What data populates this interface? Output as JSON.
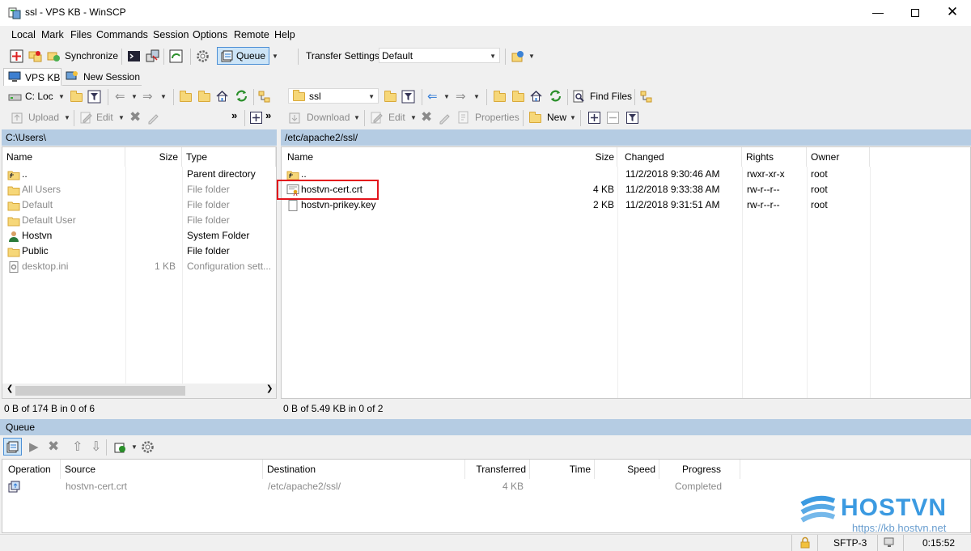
{
  "window": {
    "title": "ssl - VPS KB - WinSCP"
  },
  "menu": [
    "Local",
    "Mark",
    "Files",
    "Commands",
    "Session",
    "Options",
    "Remote",
    "Help"
  ],
  "toolbar": {
    "synchronize": "Synchronize",
    "queue": "Queue",
    "transfer_settings_label": "Transfer Settings",
    "transfer_settings_value": "Default"
  },
  "tabs": [
    {
      "label": "VPS KB"
    },
    {
      "label": "New Session"
    }
  ],
  "local": {
    "drive": "C: Loc",
    "upload": "Upload",
    "edit": "Edit",
    "path": "C:\\Users\\",
    "columns": [
      "Name",
      "Size",
      "Type"
    ],
    "rows": [
      {
        "name": "..",
        "size": "",
        "type": "Parent directory",
        "icon": "parent-folder-icon",
        "dim": false
      },
      {
        "name": "All Users",
        "size": "",
        "type": "File folder",
        "icon": "folder-icon",
        "dim": true
      },
      {
        "name": "Default",
        "size": "",
        "type": "File folder",
        "icon": "folder-icon",
        "dim": true
      },
      {
        "name": "Default User",
        "size": "",
        "type": "File folder",
        "icon": "folder-icon",
        "dim": true
      },
      {
        "name": "Hostvn",
        "size": "",
        "type": "System Folder",
        "icon": "user-icon",
        "dim": false
      },
      {
        "name": "Public",
        "size": "",
        "type": "File folder",
        "icon": "folder-icon",
        "dim": false
      },
      {
        "name": "desktop.ini",
        "size": "1 KB",
        "type": "Configuration sett...",
        "icon": "settings-file-icon",
        "dim": true
      }
    ],
    "status": "0 B of 174 B in 0 of 6"
  },
  "remote": {
    "dir": "ssl",
    "find_files": "Find Files",
    "download": "Download",
    "edit": "Edit",
    "properties": "Properties",
    "new": "New",
    "path": "/etc/apache2/ssl/",
    "columns": [
      "Name",
      "Size",
      "Changed",
      "Rights",
      "Owner"
    ],
    "rows": [
      {
        "name": "..",
        "size": "",
        "changed": "11/2/2018 9:30:46 AM",
        "rights": "rwxr-xr-x",
        "owner": "root",
        "icon": "parent-folder-icon"
      },
      {
        "name": "hostvn-cert.crt",
        "size": "4 KB",
        "changed": "11/2/2018 9:33:38 AM",
        "rights": "rw-r--r--",
        "owner": "root",
        "icon": "certificate-icon"
      },
      {
        "name": "hostvn-prikey.key",
        "size": "2 KB",
        "changed": "11/2/2018 9:31:51 AM",
        "rights": "rw-r--r--",
        "owner": "root",
        "icon": "file-icon"
      }
    ],
    "status": "0 B of 5.49 KB in 0 of 2"
  },
  "queue": {
    "title": "Queue",
    "columns": [
      "Operation",
      "Source",
      "Destination",
      "Transferred",
      "Time",
      "Speed",
      "Progress"
    ],
    "rows": [
      {
        "source": "hostvn-cert.crt",
        "destination": "/etc/apache2/ssl/",
        "transferred": "4 KB",
        "time": "",
        "speed": "",
        "progress": "Completed"
      }
    ]
  },
  "statusbar": {
    "protocol": "SFTP-3",
    "time": "0:15:52"
  },
  "watermark": {
    "brand": "HOSTVN",
    "url": "https://kb.hostvn.net"
  },
  "colors": {
    "path_bar": "#b5cce3",
    "highlight": "#e3141c",
    "brand_blue": "#3b9ae1"
  }
}
